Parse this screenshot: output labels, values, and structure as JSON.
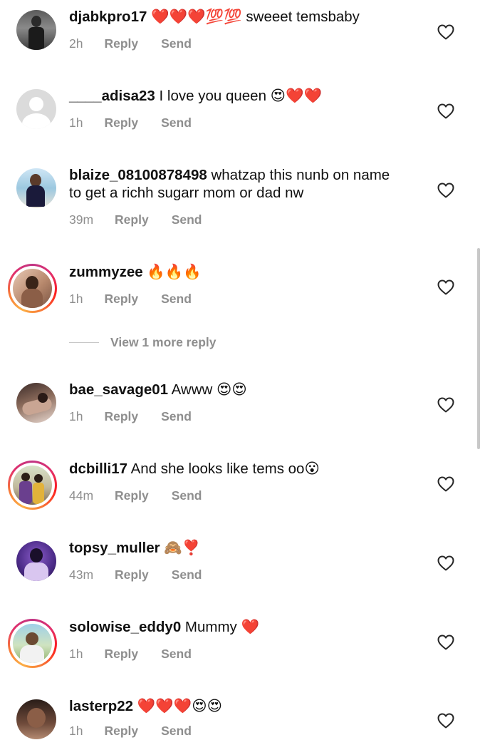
{
  "comments": [
    {
      "username": "djabkpro17",
      "text": " ❤️❤️❤️💯💯 sweeet temsbaby",
      "time": "2h",
      "reply": "Reply",
      "send": "Send"
    },
    {
      "username": "____adisa23",
      "text": " I love you queen 😍❤️❤️",
      "time": "1h",
      "reply": "Reply",
      "send": "Send"
    },
    {
      "username": "blaize_08100878498",
      "text": " whatzap this nunb on name to get a richh sugarr mom or dad nw",
      "time": "39m",
      "reply": "Reply",
      "send": "Send"
    },
    {
      "username": "zummyzee",
      "text": " 🔥🔥🔥",
      "time": "1h",
      "reply": "Reply",
      "send": "Send"
    },
    {
      "username": "bae_savage01",
      "text": " Awww 😍😍",
      "time": "1h",
      "reply": "Reply",
      "send": "Send"
    },
    {
      "username": "dcbilli17",
      "text": " And she looks like tems oo😮",
      "time": "44m",
      "reply": "Reply",
      "send": "Send"
    },
    {
      "username": "topsy_muller",
      "text": " 🙈❣️",
      "time": "43m",
      "reply": "Reply",
      "send": "Send"
    },
    {
      "username": "solowise_eddy0",
      "text": " Mummy ❤️",
      "time": "1h",
      "reply": "Reply",
      "send": "Send"
    },
    {
      "username": "lasterp22",
      "text": " ❤️❤️❤️😍😍",
      "time": "1h",
      "reply": "Reply",
      "send": "Send"
    }
  ],
  "view_more": "View 1 more reply",
  "icons": {
    "like": "heart-outline-icon"
  },
  "colors": {
    "meta_gray": "#8e8e8e",
    "story_ring": "#e1306c"
  }
}
